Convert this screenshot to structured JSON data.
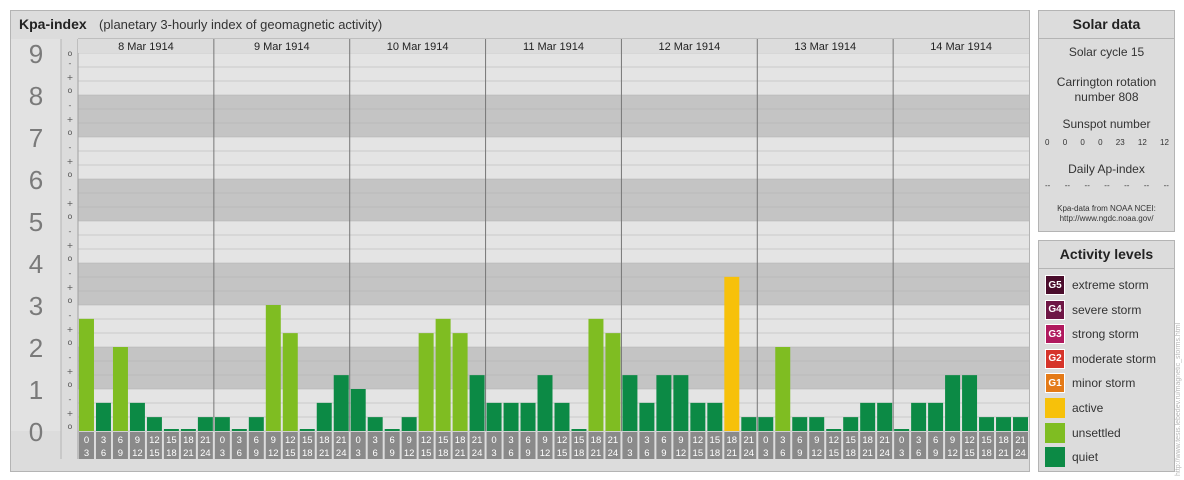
{
  "kp_panel": {
    "title": "Kpa-index",
    "subtitle": "(planetary 3-hourly index of geomagnetic activity)"
  },
  "solar_panel": {
    "heading": "Solar data",
    "solar_cycle": "Solar cycle 15",
    "carrington_line1": "Carrington rotation",
    "carrington_line2": "number 808",
    "sunspot_label": "Sunspot number",
    "sunspot_values": [
      "0",
      "0",
      "0",
      "0",
      "23",
      "12",
      "12"
    ],
    "ap_label": "Daily Ap-index",
    "ap_values": [
      "--",
      "--",
      "--",
      "--",
      "--",
      "--",
      "--"
    ],
    "source_line1": "Kpa-data from NOAA NCEI:",
    "source_line2": "http://www.ngdc.noaa.gov/"
  },
  "activity_panel": {
    "heading": "Activity levels",
    "levels": [
      {
        "code": "G5",
        "label": "extreme storm",
        "color": "#4a0d2c"
      },
      {
        "code": "G4",
        "label": "severe storm",
        "color": "#6e1645"
      },
      {
        "code": "G3",
        "label": "strong storm",
        "color": "#b0195e"
      },
      {
        "code": "G2",
        "label": "moderate storm",
        "color": "#d6342a"
      },
      {
        "code": "G1",
        "label": "minor storm",
        "color": "#e47a18"
      },
      {
        "code": "",
        "label": "active",
        "color": "#f7c10a"
      },
      {
        "code": "",
        "label": "unsettled",
        "color": "#7fbd22"
      },
      {
        "code": "",
        "label": "quiet",
        "color": "#0c8a45"
      }
    ]
  },
  "credit": "http://www.tesis.lebedev.ru/magnetic_storms.html",
  "chart_data": {
    "type": "bar",
    "title": "Kpa-index",
    "subtitle": "(planetary 3-hourly index of geomagnetic activity)",
    "ylim": [
      0,
      9
    ],
    "y_ticks": [
      "0",
      "1",
      "2",
      "3",
      "4",
      "5",
      "6",
      "7",
      "8",
      "9"
    ],
    "minor_ticks": [
      "o",
      "+",
      "-"
    ],
    "days": [
      "8 Mar 1914",
      "9 Mar 1914",
      "10 Mar 1914",
      "11 Mar 1914",
      "12 Mar 1914",
      "13 Mar 1914",
      "14 Mar 1914"
    ],
    "interval_top": [
      "0",
      "3",
      "6",
      "9",
      "12",
      "15",
      "18",
      "21"
    ],
    "interval_bottom": [
      "3",
      "6",
      "9",
      "12",
      "15",
      "18",
      "21",
      "24"
    ],
    "values": [
      [
        2.67,
        0.67,
        2.0,
        0.67,
        0.33,
        0.0,
        0.0,
        0.33
      ],
      [
        0.33,
        0.0,
        0.33,
        3.0,
        2.33,
        0.0,
        0.67,
        1.33
      ],
      [
        1.0,
        0.33,
        0.0,
        0.33,
        2.33,
        2.67,
        2.33,
        1.33
      ],
      [
        0.67,
        0.67,
        0.67,
        1.33,
        0.67,
        0.0,
        2.67,
        2.33
      ],
      [
        1.33,
        0.67,
        1.33,
        1.33,
        0.67,
        0.67,
        3.67,
        0.33
      ],
      [
        0.33,
        2.0,
        0.33,
        0.33,
        0.0,
        0.33,
        0.67,
        0.67
      ],
      [
        0.0,
        0.67,
        0.67,
        1.33,
        1.33,
        0.33,
        0.33,
        0.33
      ]
    ],
    "colors": {
      "quiet": "#0c8a45",
      "unsettled": "#7fbd22",
      "active": "#f7c10a",
      "band_dark": "#c4c4c4",
      "band_light": "#e4e4e4",
      "axis_box": "#8a8a8a"
    }
  }
}
